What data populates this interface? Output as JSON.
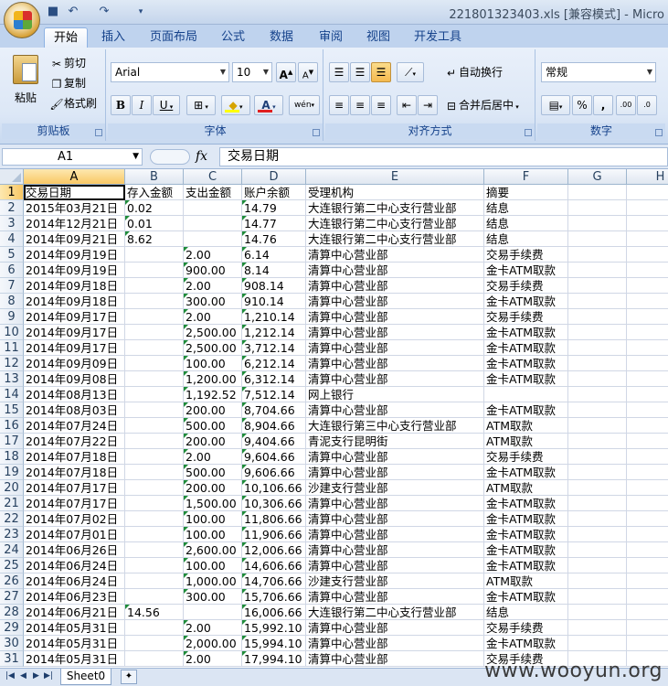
{
  "window": {
    "title": "221801323403.xls  [兼容模式] - Micro",
    "qat_icons": [
      "save-icon",
      "undo-icon",
      "redo-icon",
      "customize-icon"
    ]
  },
  "ribbon_tabs": [
    "开始",
    "插入",
    "页面布局",
    "公式",
    "数据",
    "审阅",
    "视图",
    "开发工具"
  ],
  "ribbon": {
    "clipboard": {
      "label": "剪贴板",
      "paste": "粘贴",
      "cut": "剪切",
      "copy": "复制",
      "format_painter": "格式刷"
    },
    "font": {
      "label": "字体",
      "font_name": "Arial",
      "font_size": "10",
      "bold": "B",
      "italic": "I",
      "underline": "U",
      "grow": "A",
      "shrink": "A",
      "phonetic": "wén"
    },
    "alignment": {
      "label": "对齐方式",
      "wrap_text": "自动换行",
      "merge_center": "合并后居中"
    },
    "number": {
      "label": "数字",
      "format": "常规",
      "percent": "%",
      "comma": ",",
      "inc_decimal": ".00",
      "dec_decimal": ".0"
    }
  },
  "formula_bar": {
    "name_box": "A1",
    "fx": "fx",
    "content": "交易日期"
  },
  "columns": [
    "A",
    "B",
    "C",
    "D",
    "E",
    "F",
    "G",
    "H"
  ],
  "rows": [
    [
      "交易日期",
      "存入金额",
      "支出金额",
      "账户余额",
      "受理机构",
      "摘要"
    ],
    [
      "2015年03月21日",
      "0.02",
      "",
      "14.79",
      "大连银行第二中心支行营业部",
      "结息"
    ],
    [
      "2014年12月21日",
      "0.01",
      "",
      "14.77",
      "大连银行第二中心支行营业部",
      "结息"
    ],
    [
      "2014年09月21日",
      "8.62",
      "",
      "14.76",
      "大连银行第二中心支行营业部",
      "结息"
    ],
    [
      "2014年09月19日",
      "",
      "2.00",
      "6.14",
      "清算中心营业部",
      "交易手续费"
    ],
    [
      "2014年09月19日",
      "",
      "900.00",
      "8.14",
      "清算中心营业部",
      "金卡ATM取款"
    ],
    [
      "2014年09月18日",
      "",
      "2.00",
      "908.14",
      "清算中心营业部",
      "交易手续费"
    ],
    [
      "2014年09月18日",
      "",
      "300.00",
      "910.14",
      "清算中心营业部",
      "金卡ATM取款"
    ],
    [
      "2014年09月17日",
      "",
      "2.00",
      "1,210.14",
      "清算中心营业部",
      "交易手续费"
    ],
    [
      "2014年09月17日",
      "",
      "2,500.00",
      "1,212.14",
      "清算中心营业部",
      "金卡ATM取款"
    ],
    [
      "2014年09月17日",
      "",
      "2,500.00",
      "3,712.14",
      "清算中心营业部",
      "金卡ATM取款"
    ],
    [
      "2014年09月09日",
      "",
      "100.00",
      "6,212.14",
      "清算中心营业部",
      "金卡ATM取款"
    ],
    [
      "2014年09月08日",
      "",
      "1,200.00",
      "6,312.14",
      "清算中心营业部",
      "金卡ATM取款"
    ],
    [
      "2014年08月13日",
      "",
      "1,192.52",
      "7,512.14",
      "网上银行",
      ""
    ],
    [
      "2014年08月03日",
      "",
      "200.00",
      "8,704.66",
      "清算中心营业部",
      "金卡ATM取款"
    ],
    [
      "2014年07月24日",
      "",
      "500.00",
      "8,904.66",
      "大连银行第三中心支行营业部",
      "ATM取款"
    ],
    [
      "2014年07月22日",
      "",
      "200.00",
      "9,404.66",
      "青泥支行昆明街",
      "ATM取款"
    ],
    [
      "2014年07月18日",
      "",
      "2.00",
      "9,604.66",
      "清算中心营业部",
      "交易手续费"
    ],
    [
      "2014年07月18日",
      "",
      "500.00",
      "9,606.66",
      "清算中心营业部",
      "金卡ATM取款"
    ],
    [
      "2014年07月17日",
      "",
      "200.00",
      "10,106.66",
      "沙建支行营业部",
      "ATM取款"
    ],
    [
      "2014年07月17日",
      "",
      "1,500.00",
      "10,306.66",
      "清算中心营业部",
      "金卡ATM取款"
    ],
    [
      "2014年07月02日",
      "",
      "100.00",
      "11,806.66",
      "清算中心营业部",
      "金卡ATM取款"
    ],
    [
      "2014年07月01日",
      "",
      "100.00",
      "11,906.66",
      "清算中心营业部",
      "金卡ATM取款"
    ],
    [
      "2014年06月26日",
      "",
      "2,600.00",
      "12,006.66",
      "清算中心营业部",
      "金卡ATM取款"
    ],
    [
      "2014年06月24日",
      "",
      "100.00",
      "14,606.66",
      "清算中心营业部",
      "金卡ATM取款"
    ],
    [
      "2014年06月24日",
      "",
      "1,000.00",
      "14,706.66",
      "沙建支行营业部",
      "ATM取款"
    ],
    [
      "2014年06月23日",
      "",
      "300.00",
      "15,706.66",
      "清算中心营业部",
      "金卡ATM取款"
    ],
    [
      "2014年06月21日",
      "14.56",
      "",
      "16,006.66",
      "大连银行第二中心支行营业部",
      "结息"
    ],
    [
      "2014年05月31日",
      "",
      "2.00",
      "15,992.10",
      "清算中心营业部",
      "交易手续费"
    ],
    [
      "2014年05月31日",
      "",
      "2,000.00",
      "15,994.10",
      "清算中心营业部",
      "金卡ATM取款"
    ],
    [
      "2014年05月31日",
      "",
      "2.00",
      "17,994.10",
      "清算中心营业部",
      "交易手续费"
    ]
  ],
  "sheet_tab": "Sheet0",
  "watermark": "www.wooyun.org"
}
